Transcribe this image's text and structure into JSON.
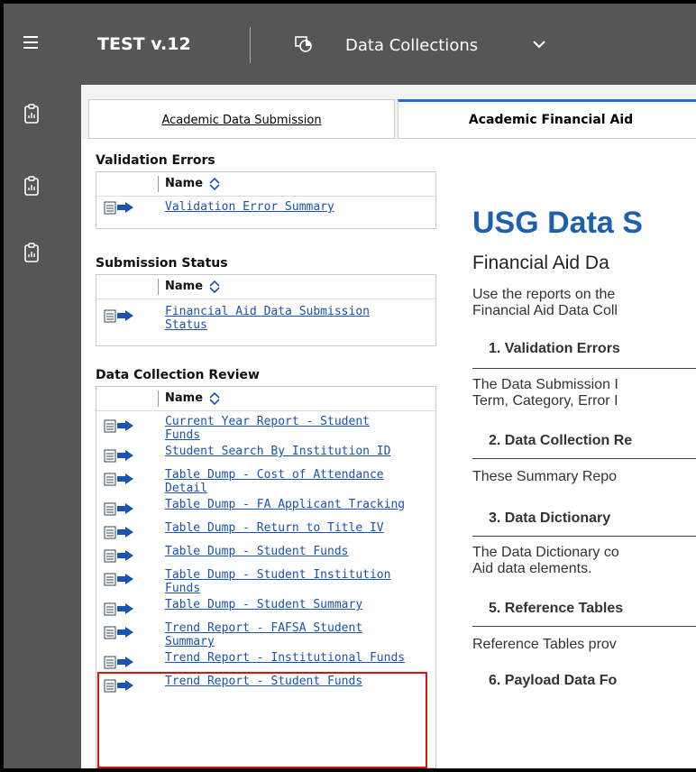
{
  "topbar": {
    "app_title": "TEST v.12",
    "collection_label": "Data Collections",
    "menu_icon": "hamburger-icon",
    "collection_icon": "data-collections-icon",
    "dropdown_icon": "chevron-down-icon"
  },
  "leftrail": {
    "icons": [
      "report-clipboard-icon",
      "report-clipboard-icon",
      "report-clipboard-icon"
    ]
  },
  "tabs": [
    {
      "label": "Academic Data Submission",
      "active": false
    },
    {
      "label": "Academic Financial Aid",
      "active": true
    }
  ],
  "sections": [
    {
      "title": "Validation Errors",
      "header": "Name",
      "reports": [
        {
          "lines": [
            "Validation Error Summary"
          ]
        }
      ]
    },
    {
      "title": "Submission Status",
      "header": "Name",
      "reports": [
        {
          "lines": [
            "Financial Aid Data Submission",
            "Status"
          ]
        }
      ]
    },
    {
      "title": "Data Collection Review",
      "header": "Name",
      "reports": [
        {
          "lines": [
            "Current Year Report - Student",
            "Funds"
          ]
        },
        {
          "lines": [
            "Student Search By Institution ID"
          ]
        },
        {
          "lines": [
            "Table Dump - Cost of Attendance",
            "Detail"
          ]
        },
        {
          "lines": [
            "Table Dump - FA Applicant Tracking"
          ]
        },
        {
          "lines": [
            "Table Dump - Return to Title IV"
          ]
        },
        {
          "lines": [
            "Table Dump - Student Funds"
          ]
        },
        {
          "lines": [
            "Table Dump - Student Institution",
            "Funds"
          ]
        },
        {
          "lines": [
            "Table Dump - Student Summary"
          ]
        },
        {
          "lines": [
            "Trend Report - FAFSA Student",
            "Summary"
          ]
        },
        {
          "lines": [
            "Trend Report - Institutional Funds"
          ]
        },
        {
          "lines": [
            "Trend Report - Student Funds"
          ]
        }
      ]
    }
  ],
  "right": {
    "heading": "USG Data S",
    "subheading": "Financial Aid Da",
    "intro_line1": "Use the reports on the",
    "intro_line2": "Financial Aid Data Coll",
    "s1_title": "1. Validation Errors",
    "s1_line1": "The Data Submission I",
    "s1_line2": "Term, Category, Error I",
    "s2_title": "2. Data Collection Re",
    "s2_line1": "These Summary Repo",
    "s3_title": "3. Data Dictionary",
    "s3_line1": "The Data Dictionary co",
    "s3_line2": "Aid data elements.",
    "s5_title": "5. Reference Tables",
    "s5_line1": "Reference Tables prov",
    "s6_title": "6. Payload Data Fo"
  },
  "colors": {
    "topbar": "#565656",
    "link": "#1a52b0",
    "heading": "#1e5fb0",
    "active_tab": "#1f6fd2",
    "highlight": "#e01010"
  }
}
